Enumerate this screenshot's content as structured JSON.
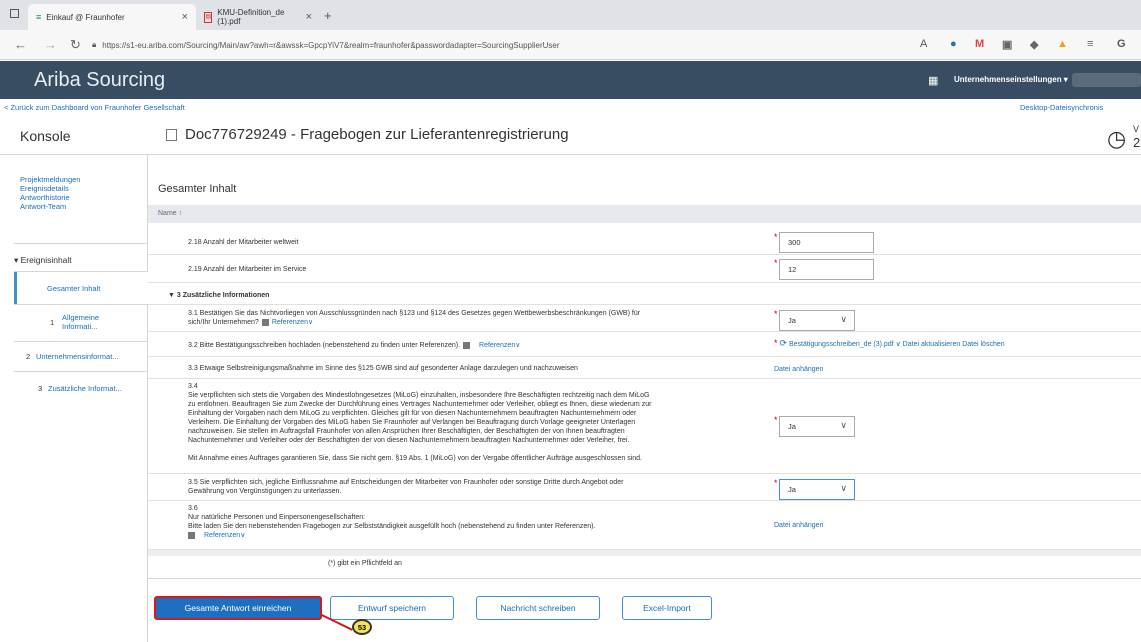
{
  "browser": {
    "tabs": [
      {
        "label": "Einkauf @ Fraunhofer"
      },
      {
        "label": "KMU-Definition_de (1).pdf"
      }
    ],
    "new_tab": "+",
    "url": "https://s1-eu.ariba.com/Sourcing/Main/aw?awh=r&awssk=GpcpYiV7&realm=fraunhofer&passwordadapter=SourcingSupplierUser"
  },
  "app": {
    "brand": "Ariba Sourcing",
    "company_settings": "Unternehmenseinstellungen ▾"
  },
  "breadcrumb": {
    "back": "< Zurück zum Dashboard von Fraunhofer Gesellschaft",
    "desktop_sync": "Desktop-Dateisynchronis"
  },
  "header": {
    "console_title": "Konsole",
    "doc_title": "Doc776729249 - Fragebogen zur Lieferantenregistrierung",
    "clock_text_1": "V",
    "clock_text_2": "2"
  },
  "sidebar": {
    "links": [
      "Projektmeldungen",
      "Ereignisdetails",
      "Antworthistorie",
      "Antwort-Team"
    ],
    "event_content": "▾ Ereignisinhalt",
    "items": [
      {
        "label": "Gesamter Inhalt"
      },
      {
        "num": "1",
        "label": "Allgemeine Informati..."
      },
      {
        "num": "2",
        "label": "Unternehmensinformat..."
      },
      {
        "num": "3",
        "label": "Zusätzliche Informat..."
      }
    ]
  },
  "content": {
    "heading": "Gesamter Inhalt",
    "name_header": "Name ↑",
    "rows": [
      {
        "label": "2.18  Anzahl der Mitarbeiter weltweit",
        "value": "300"
      },
      {
        "label": "2.19  Anzahl der Mitarbeiter im Service",
        "value": "12"
      }
    ],
    "section3": "▼ 3  Zusätzliche Informationen",
    "q31": "3.1  Bestätigen Sie das Nichtvorliegen von Ausschlussgründen nach §123 und §124 des Gesetzes gegen Wettbewerbsbeschränkungen (GWB) für",
    "q31b": "sich/Ihr Unternehmen?",
    "q31_value": "Ja",
    "q32": "3.2  Bitte Bestätigungsschreiben hochladen (nebenstehend zu finden unter Referenzen).",
    "q32_file": "Bestätigungsschreiben_de (3).pdf ∨",
    "q32_update": "Datei aktualisieren",
    "q32_delete": "Datei löschen",
    "q33": "3.3  Etwaige Selbstreinigungsmaßnahme im Sinne des §125 GWB sind auf gesonderter Anlage darzulegen und nachzuweisen",
    "q33_attach": "Datei anhängen",
    "q34_num": "3.4",
    "q34_lines": [
      "Sie verpflichten sich stets die Vorgaben des Mindestlohngesetzes (MiLoG) einzuhalten, insbesondere Ihre Beschäftigten rechtzeitig nach dem MiLoG",
      "zu entlohnen. Beauftragen Sie zum Zwecke der Durchführung eines Vertrages Nachunternehmer oder Verleiher, obliegt es Ihnen, diese wiederum zur",
      "Einhaltung der Vorgaben nach dem MiLoG zu verpflichten. Gleiches gilt für von diesen Nachunternehmern beauftragten Nachunternehmern oder",
      "Verleihern. Die Einhaltung der Vorgaben des MiLoG haben Sie Fraunhofer auf Verlangen bei Beauftragung durch Vorlage geeigneter Unterlagen",
      "nachzuweisen. Sie stellen im Auftragsfall Fraunhofer von allen Ansprüchen Ihrer Beschäftigten, der Beschäftigten der von Ihnen beauftragten",
      "Nachunternehmer und Verleiher oder der Beschäftigten der von diesen Nachunternehmern beauftragten Nachunternehmer oder Verleiher, frei."
    ],
    "q34_last": "Mit Annahme eines Auftrages garantieren Sie, dass Sie nicht gem. §19 Abs. 1 (MiLoG) von der Vergabe öffentlicher Aufträge ausgeschlossen sind.",
    "q34_value": "Ja",
    "q35": "3.5  Sie verpflichten sich, jegliche Einflussnahme auf Entscheidungen der Mitarbeiter von Fraunhofer oder sonstige Dritte durch Angebot oder",
    "q35b": "Gewährung von Vergünstigungen zu unterlassen.",
    "q35_value": "Ja",
    "q36_num": "3.6",
    "q36a": "Nur natürliche Personen und Einpersonengesellschaften:",
    "q36b": "Bitte laden Sie den nebenstehenden Fragebogen zur Selbstständigkeit ausgefüllt hoch (nebenstehend zu finden unter Referenzen).",
    "q36_attach": "Datei anhängen",
    "references": "Referenzen∨",
    "required_note": "(*) gibt ein Pflichtfeld an"
  },
  "buttons": {
    "submit": "Gesamte Antwort einreichen",
    "save_draft": "Entwurf speichern",
    "message": "Nachricht schreiben",
    "excel": "Excel-Import"
  },
  "annotation": {
    "step": "53"
  },
  "colors": {
    "topbar": "#394d62",
    "primary": "#1f6fc0",
    "highlight": "#d61a1a",
    "link": "#1a6fb3"
  }
}
